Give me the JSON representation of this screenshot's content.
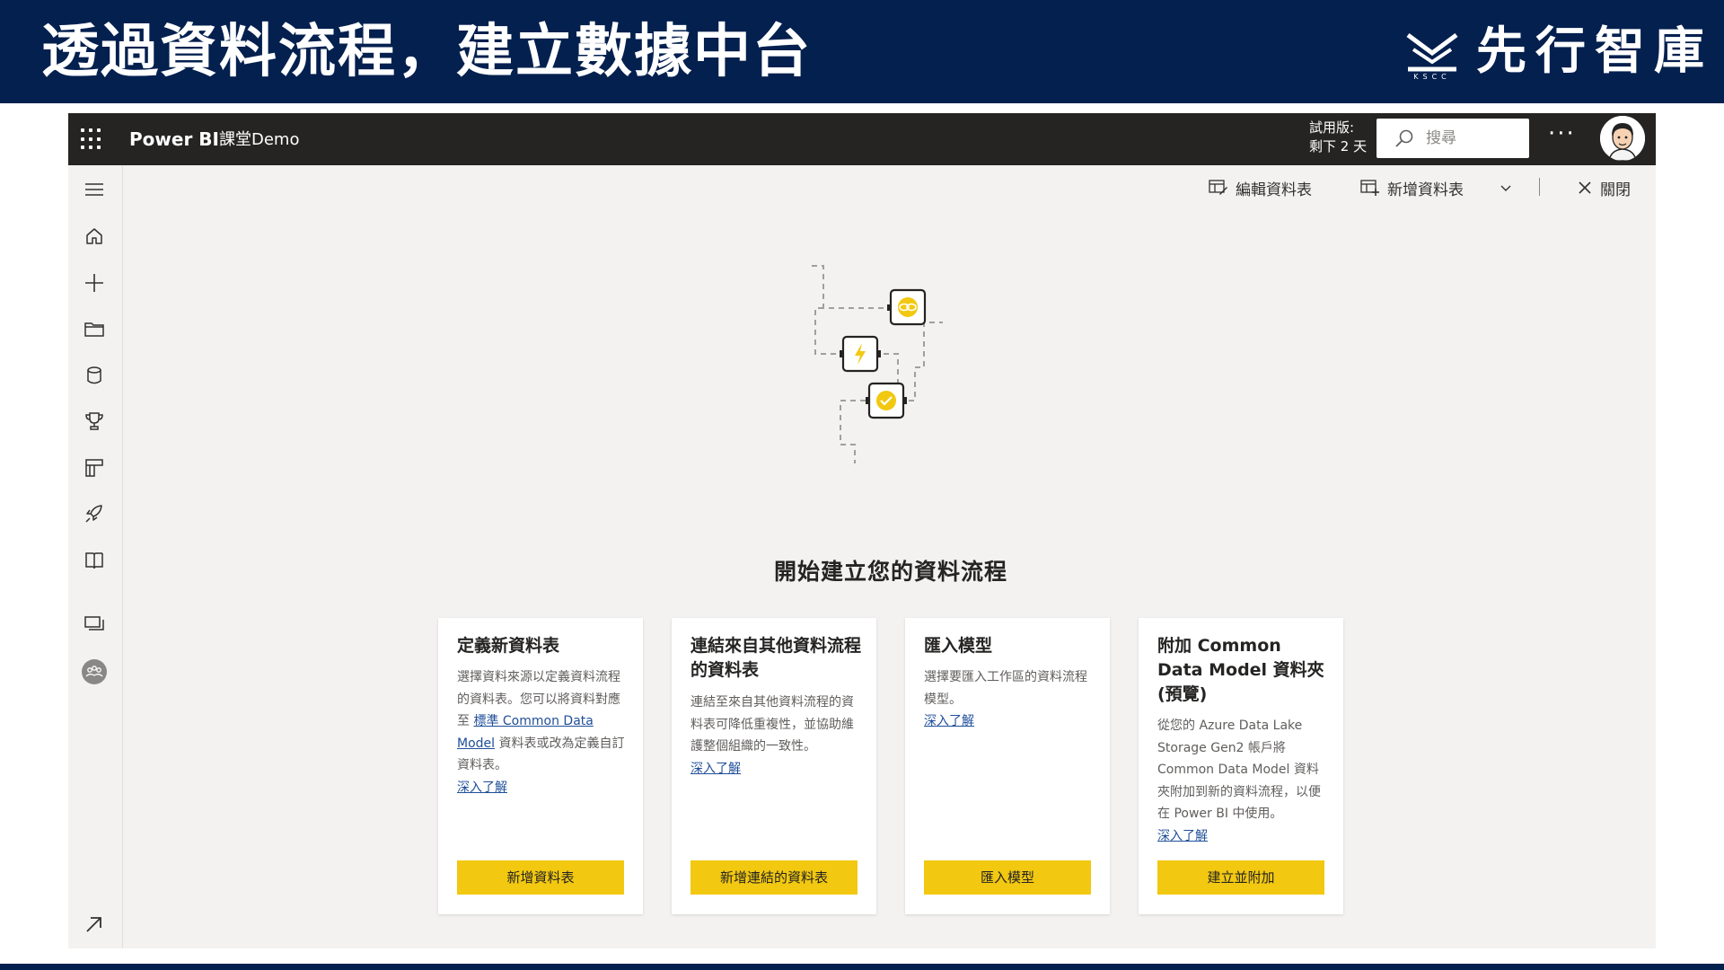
{
  "slide": {
    "title": "透過資料流程，建立數據中台",
    "brand_name": "先行智庫",
    "brand_logo_text": "KSCC",
    "banner_color": "#03204f"
  },
  "app": {
    "name": "Power BI",
    "workspace": "課堂Demo",
    "trial_line1": "試用版:",
    "trial_line2": "剩下 2 天",
    "search_placeholder": "搜尋",
    "more_label": "···",
    "accent_color": "#f2c811",
    "topbar_color": "#252423"
  },
  "nav": {
    "items": [
      "hamburger-icon",
      "home-icon",
      "plus-icon",
      "folder-icon",
      "datasets-icon",
      "trophy-icon",
      "apps-icon",
      "rocket-icon",
      "learn-book-icon",
      "workspaces-icon",
      "workspace-avatar-icon",
      "expand-arrow-icon"
    ]
  },
  "commands": {
    "edit_tables": "編輯資料表",
    "add_tables": "新增資料表",
    "close": "關閉"
  },
  "main": {
    "heading": "開始建立您的資料流程"
  },
  "cards": [
    {
      "title": "定義新資料表",
      "desc_before": "選擇資料來源以定義資料流程的資料表。您可以將資料對應至",
      "desc_link": "標準 Common Data Model",
      "desc_after": "資料表或改為定義自訂資料表。",
      "learn_more": "深入了解",
      "button": "新增資料表"
    },
    {
      "title": "連結來自其他資料流程的資料表",
      "desc": "連結至來自其他資料流程的資料表可降低重複性，並協助維護整個組織的一致性。",
      "learn_more": "深入了解",
      "button": "新增連結的資料表"
    },
    {
      "title": "匯入模型",
      "desc": "選擇要匯入工作區的資料流程模型。",
      "learn_more": "深入了解",
      "button": "匯入模型"
    },
    {
      "title": "附加 Common Data Model 資料夾 (預覽)",
      "desc": "從您的 Azure Data Lake Storage Gen2 帳戶將 Common Data Model 資料夾附加到新的資料流程，以便在 Power BI 中使用。",
      "learn_more": "深入了解",
      "button": "建立並附加"
    }
  ]
}
